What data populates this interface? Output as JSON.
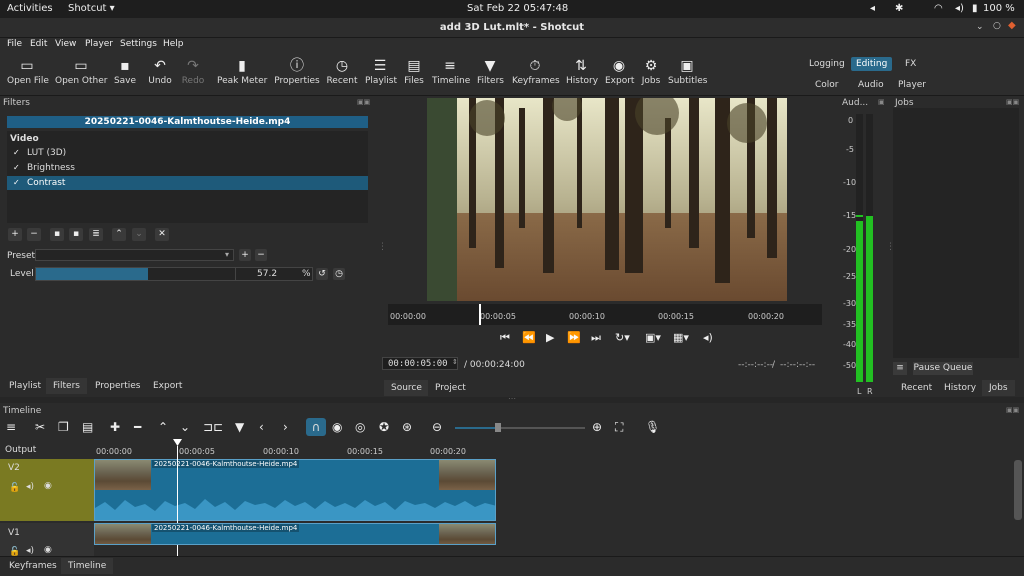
{
  "system": {
    "activities": "Activities",
    "app_menu": "Shotcut ▾",
    "clock": "Sat Feb 22  05:47:48",
    "battery": "100 %"
  },
  "window": {
    "title": "add 3D Lut.mlt* - Shotcut"
  },
  "menu": [
    "File",
    "Edit",
    "View",
    "Player",
    "Settings",
    "Help"
  ],
  "toolbar": [
    {
      "label": "Open File",
      "icon": "▭"
    },
    {
      "label": "Open Other",
      "icon": "▭"
    },
    {
      "label": "Save",
      "icon": "💾"
    },
    {
      "label": "Undo",
      "icon": "↶"
    },
    {
      "label": "Redo",
      "icon": "↷"
    },
    {
      "label": "Peak Meter",
      "icon": "▮"
    },
    {
      "label": "Properties",
      "icon": "ⓘ"
    },
    {
      "label": "Recent",
      "icon": "◷"
    },
    {
      "label": "Playlist",
      "icon": "☰"
    },
    {
      "label": "Files",
      "icon": "▤"
    },
    {
      "label": "Timeline",
      "icon": "≡"
    },
    {
      "label": "Filters",
      "icon": "▼"
    },
    {
      "label": "Keyframes",
      "icon": "⏱"
    },
    {
      "label": "History",
      "icon": "⇅"
    },
    {
      "label": "Export",
      "icon": "◉"
    },
    {
      "label": "Jobs",
      "icon": "⚙"
    },
    {
      "label": "Subtitles",
      "icon": "▣"
    }
  ],
  "layouts": {
    "logging": "Logging",
    "editing": "Editing",
    "fx": "FX",
    "color": "Color",
    "audio": "Audio",
    "player": "Player"
  },
  "filters": {
    "panel_title": "Filters",
    "clip": "20250221-0046-Kalmthoutse-Heide.mp4",
    "group": "Video",
    "items": [
      {
        "label": "LUT (3D)",
        "checked": "✓"
      },
      {
        "label": "Brightness",
        "checked": "✓"
      },
      {
        "label": "Contrast",
        "checked": "✓"
      }
    ],
    "preset_label": "Preset",
    "level_label": "Level",
    "level_value": "57.2",
    "level_unit": "%",
    "level_fraction": 0.405
  },
  "left_tabs": [
    "Playlist",
    "Filters",
    "Properties",
    "Export"
  ],
  "player": {
    "ruler": [
      "00:00:00",
      "00:00:05",
      "00:00:10",
      "00:00:15",
      "00:00:20"
    ],
    "timecode": "00:00:05:00",
    "duration": "/ 00:00:24:00",
    "in_point": "--:--:--:--",
    "out_sep": "/",
    "out_point": "--:--:--:--",
    "tabs": [
      "Source",
      "Project"
    ]
  },
  "audio_meter": {
    "title": "Aud...",
    "scale": [
      "0",
      "-5",
      "-10",
      "-15",
      "-20",
      "-25",
      "-30",
      "-35",
      "-40",
      "-50"
    ],
    "channels": [
      "L",
      "R"
    ],
    "left_level": 0.6,
    "right_level": 0.62
  },
  "jobs": {
    "title": "Jobs",
    "pause_label": "Pause Queue",
    "tabs": [
      "Recent",
      "History",
      "Jobs"
    ]
  },
  "timeline": {
    "title": "Timeline",
    "output_label": "Output",
    "ruler": [
      "00:00:00",
      "00:00:05",
      "00:00:10",
      "00:00:15",
      "00:00:20"
    ],
    "tracks": [
      {
        "name": "V2",
        "clip": "20250221-0046-Kalmthoutse-Heide.mp4"
      },
      {
        "name": "V1",
        "clip": "20250221-0046-Kalmthoutse-Heide.mp4"
      }
    ]
  },
  "bottom_tabs": [
    "Keyframes",
    "Timeline"
  ],
  "colors": {
    "accent": "#2a6a8c",
    "selected_track": "#7a7a22",
    "clip": "#1c6e96",
    "meter": "#22c022"
  }
}
